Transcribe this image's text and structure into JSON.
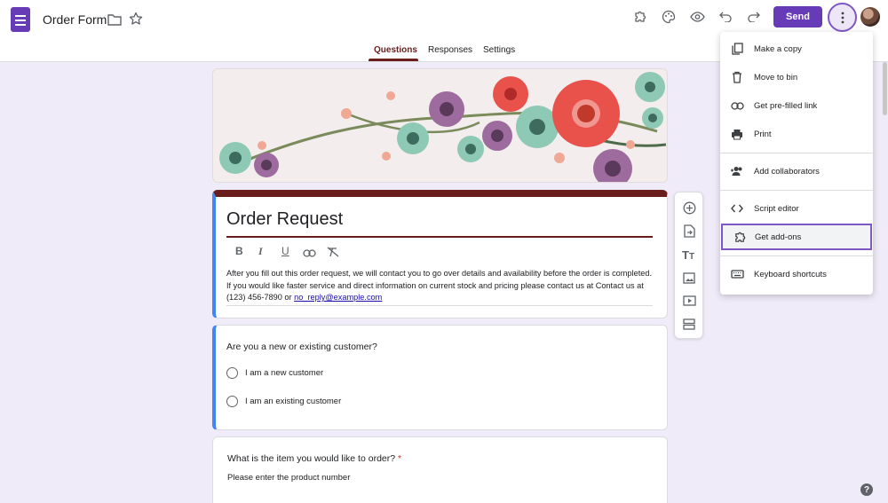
{
  "header": {
    "title": "Order Form",
    "send_label": "Send",
    "accent": "#673ab7"
  },
  "tabs": [
    {
      "label": "Questions",
      "active": true
    },
    {
      "label": "Responses",
      "active": false
    },
    {
      "label": "Settings",
      "active": false
    }
  ],
  "form": {
    "title": "Order Request",
    "description_text": "After you fill out this order request, we will contact you to go over details and availability before the order is completed. If you would like faster service and direct information on current stock and pricing please contact us at Contact us at (123) 456-7890 or ",
    "description_link": "no_reply@example.com",
    "theme_color": "#6b1d1d"
  },
  "questions": [
    {
      "title": "Are you a new or existing customer?",
      "options": [
        "I am a new customer",
        "I am an existing customer"
      ]
    },
    {
      "title": "What is the item you would like to order?",
      "required_mark": "*",
      "subtitle": "Please enter the product number"
    }
  ],
  "menu": {
    "items": [
      {
        "label": "Make a copy",
        "icon": "copy-icon"
      },
      {
        "label": "Move to bin",
        "icon": "trash-icon"
      },
      {
        "label": "Get pre-filled link",
        "icon": "link-icon"
      },
      {
        "label": "Print",
        "icon": "print-icon"
      },
      {
        "label": "Add collaborators",
        "icon": "add-people-icon"
      },
      {
        "label": "Script editor",
        "icon": "code-icon"
      },
      {
        "label": "Get add-ons",
        "icon": "puzzle-icon",
        "highlighted": true
      },
      {
        "label": "Keyboard shortcuts",
        "icon": "keyboard-icon"
      }
    ]
  },
  "help": "?"
}
